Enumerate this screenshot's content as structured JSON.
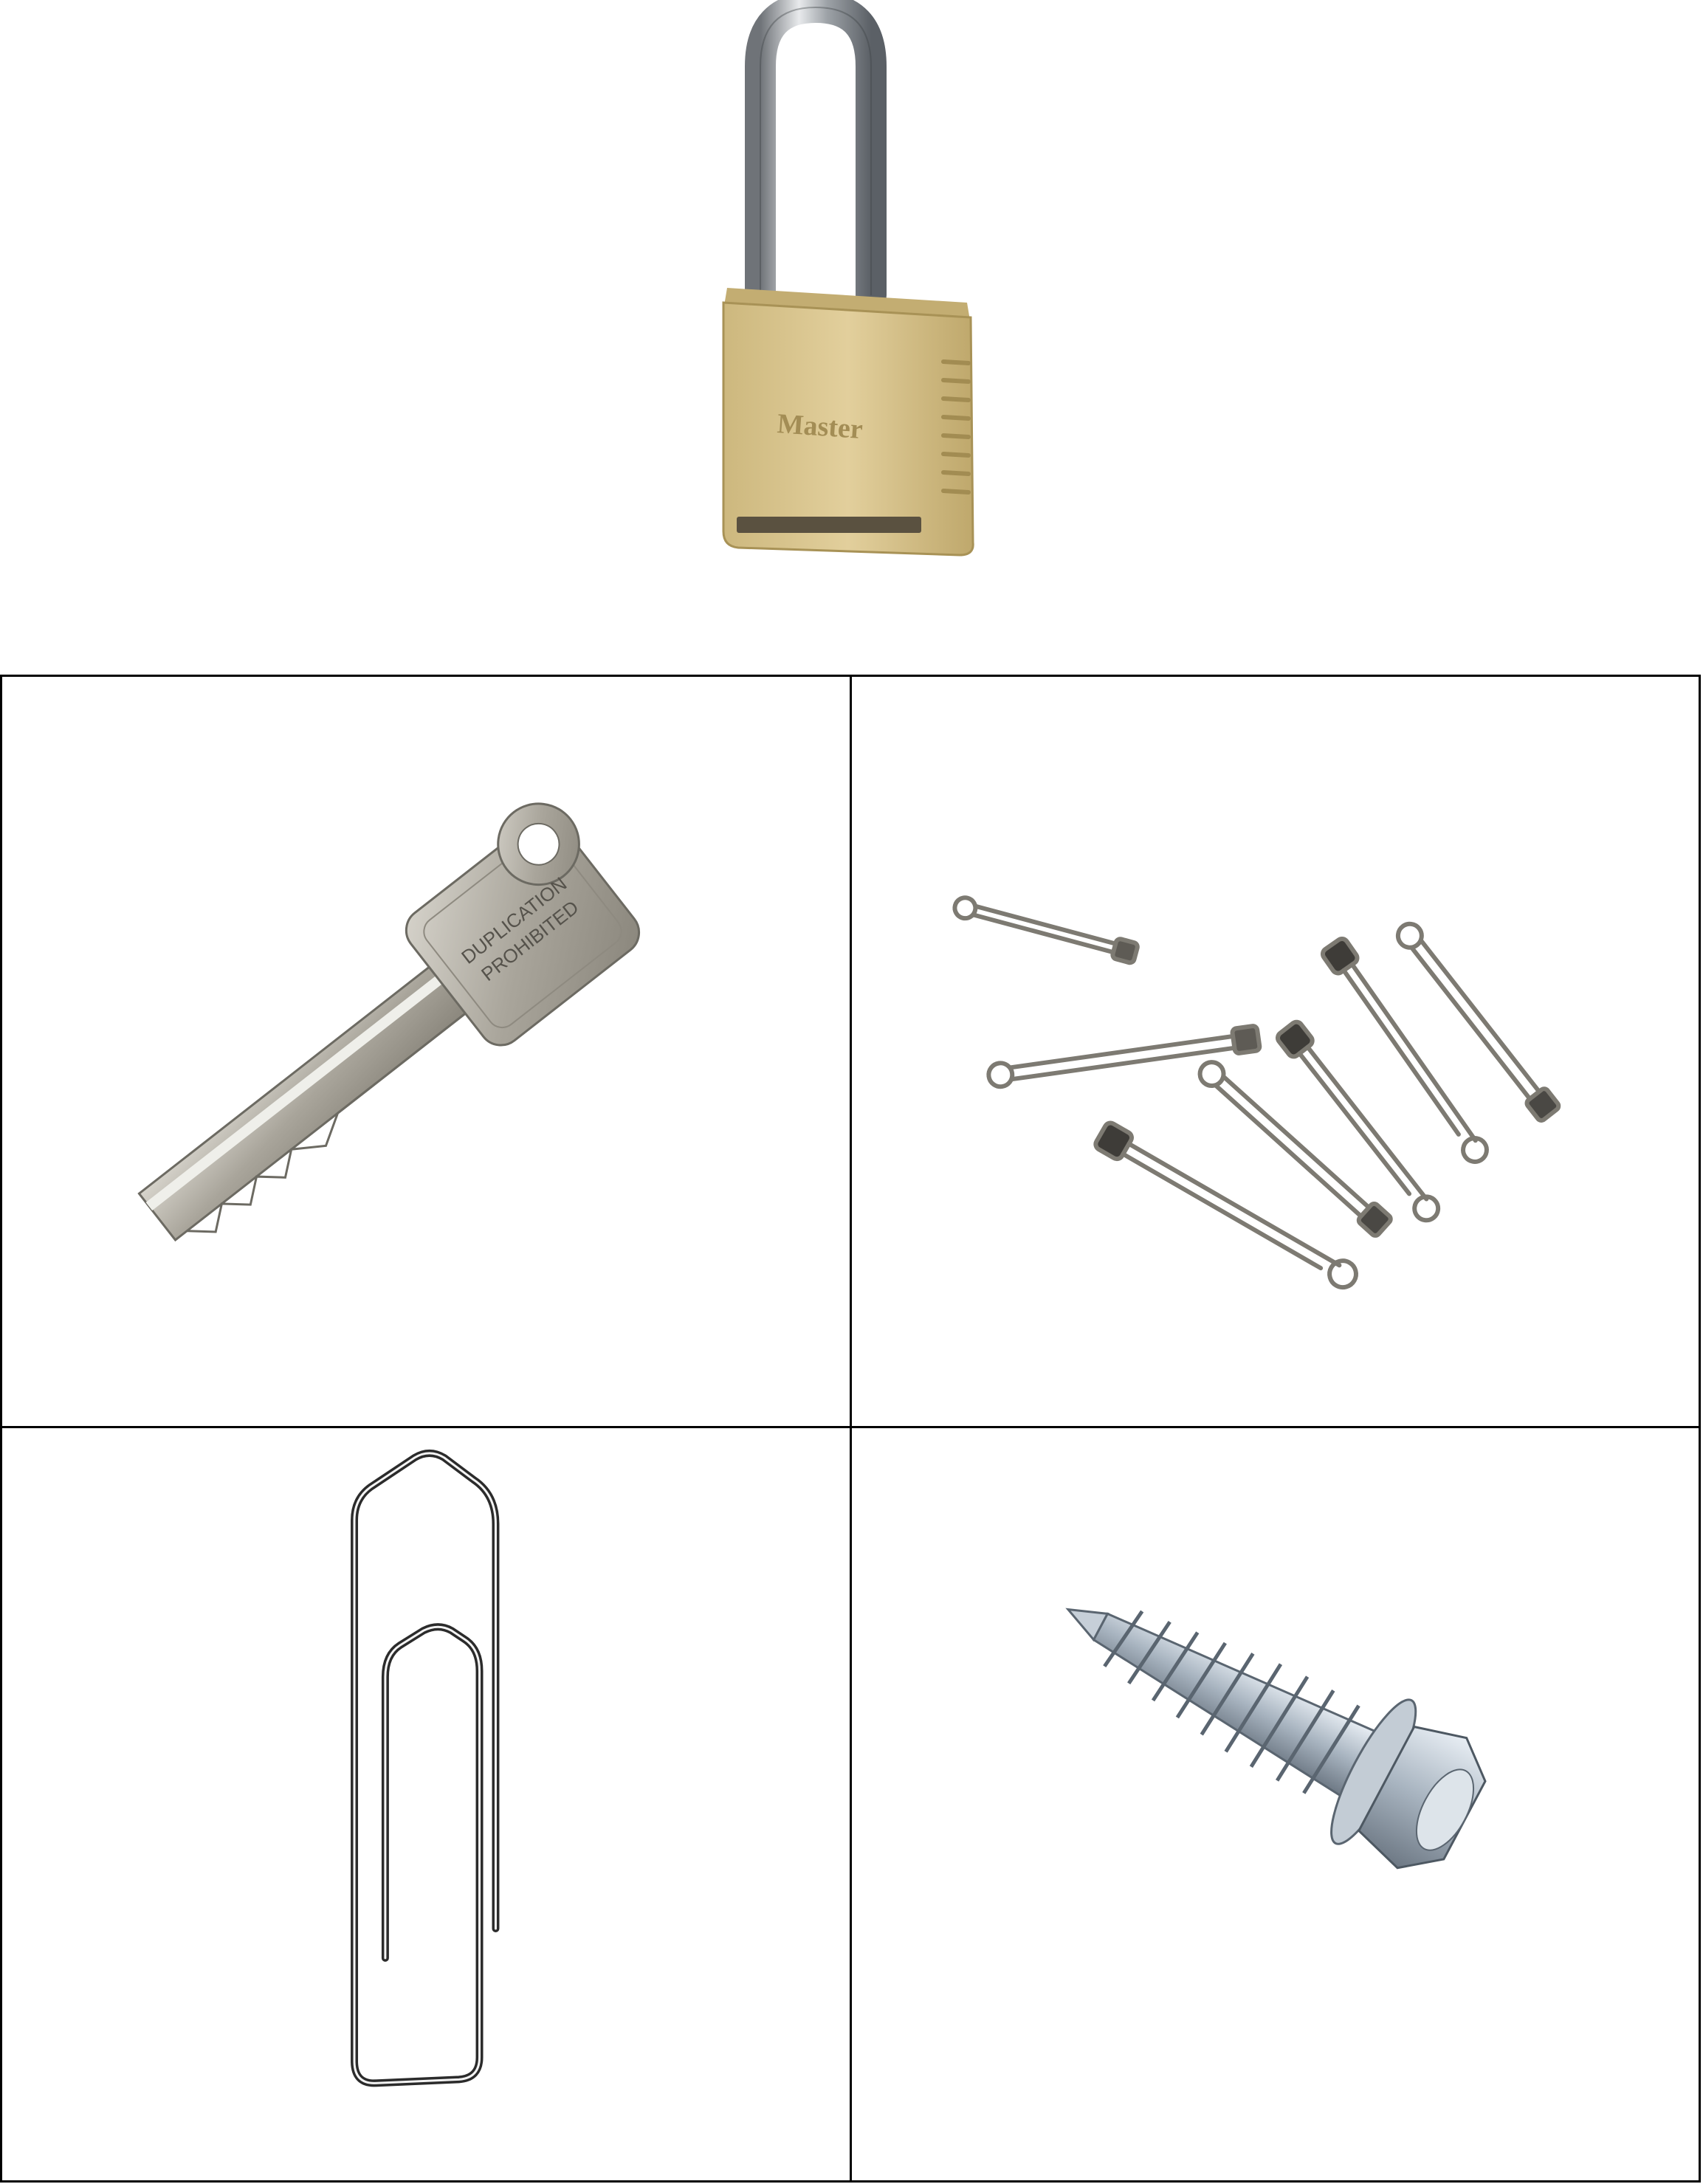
{
  "images": {
    "padlock": {
      "label": "padlock",
      "brand_text": "Master"
    },
    "key": {
      "label": "key",
      "engraving": [
        "DUPLICATION",
        "PROHIBITED"
      ]
    },
    "safety_pins": {
      "label": "safety pins"
    },
    "paperclip": {
      "label": "paperclip"
    },
    "screw": {
      "label": "hex head screw"
    }
  },
  "colors": {
    "brass": "#d8c38c",
    "steel": "#b9bcc0",
    "border": "#000000",
    "background": "#ffffff"
  }
}
